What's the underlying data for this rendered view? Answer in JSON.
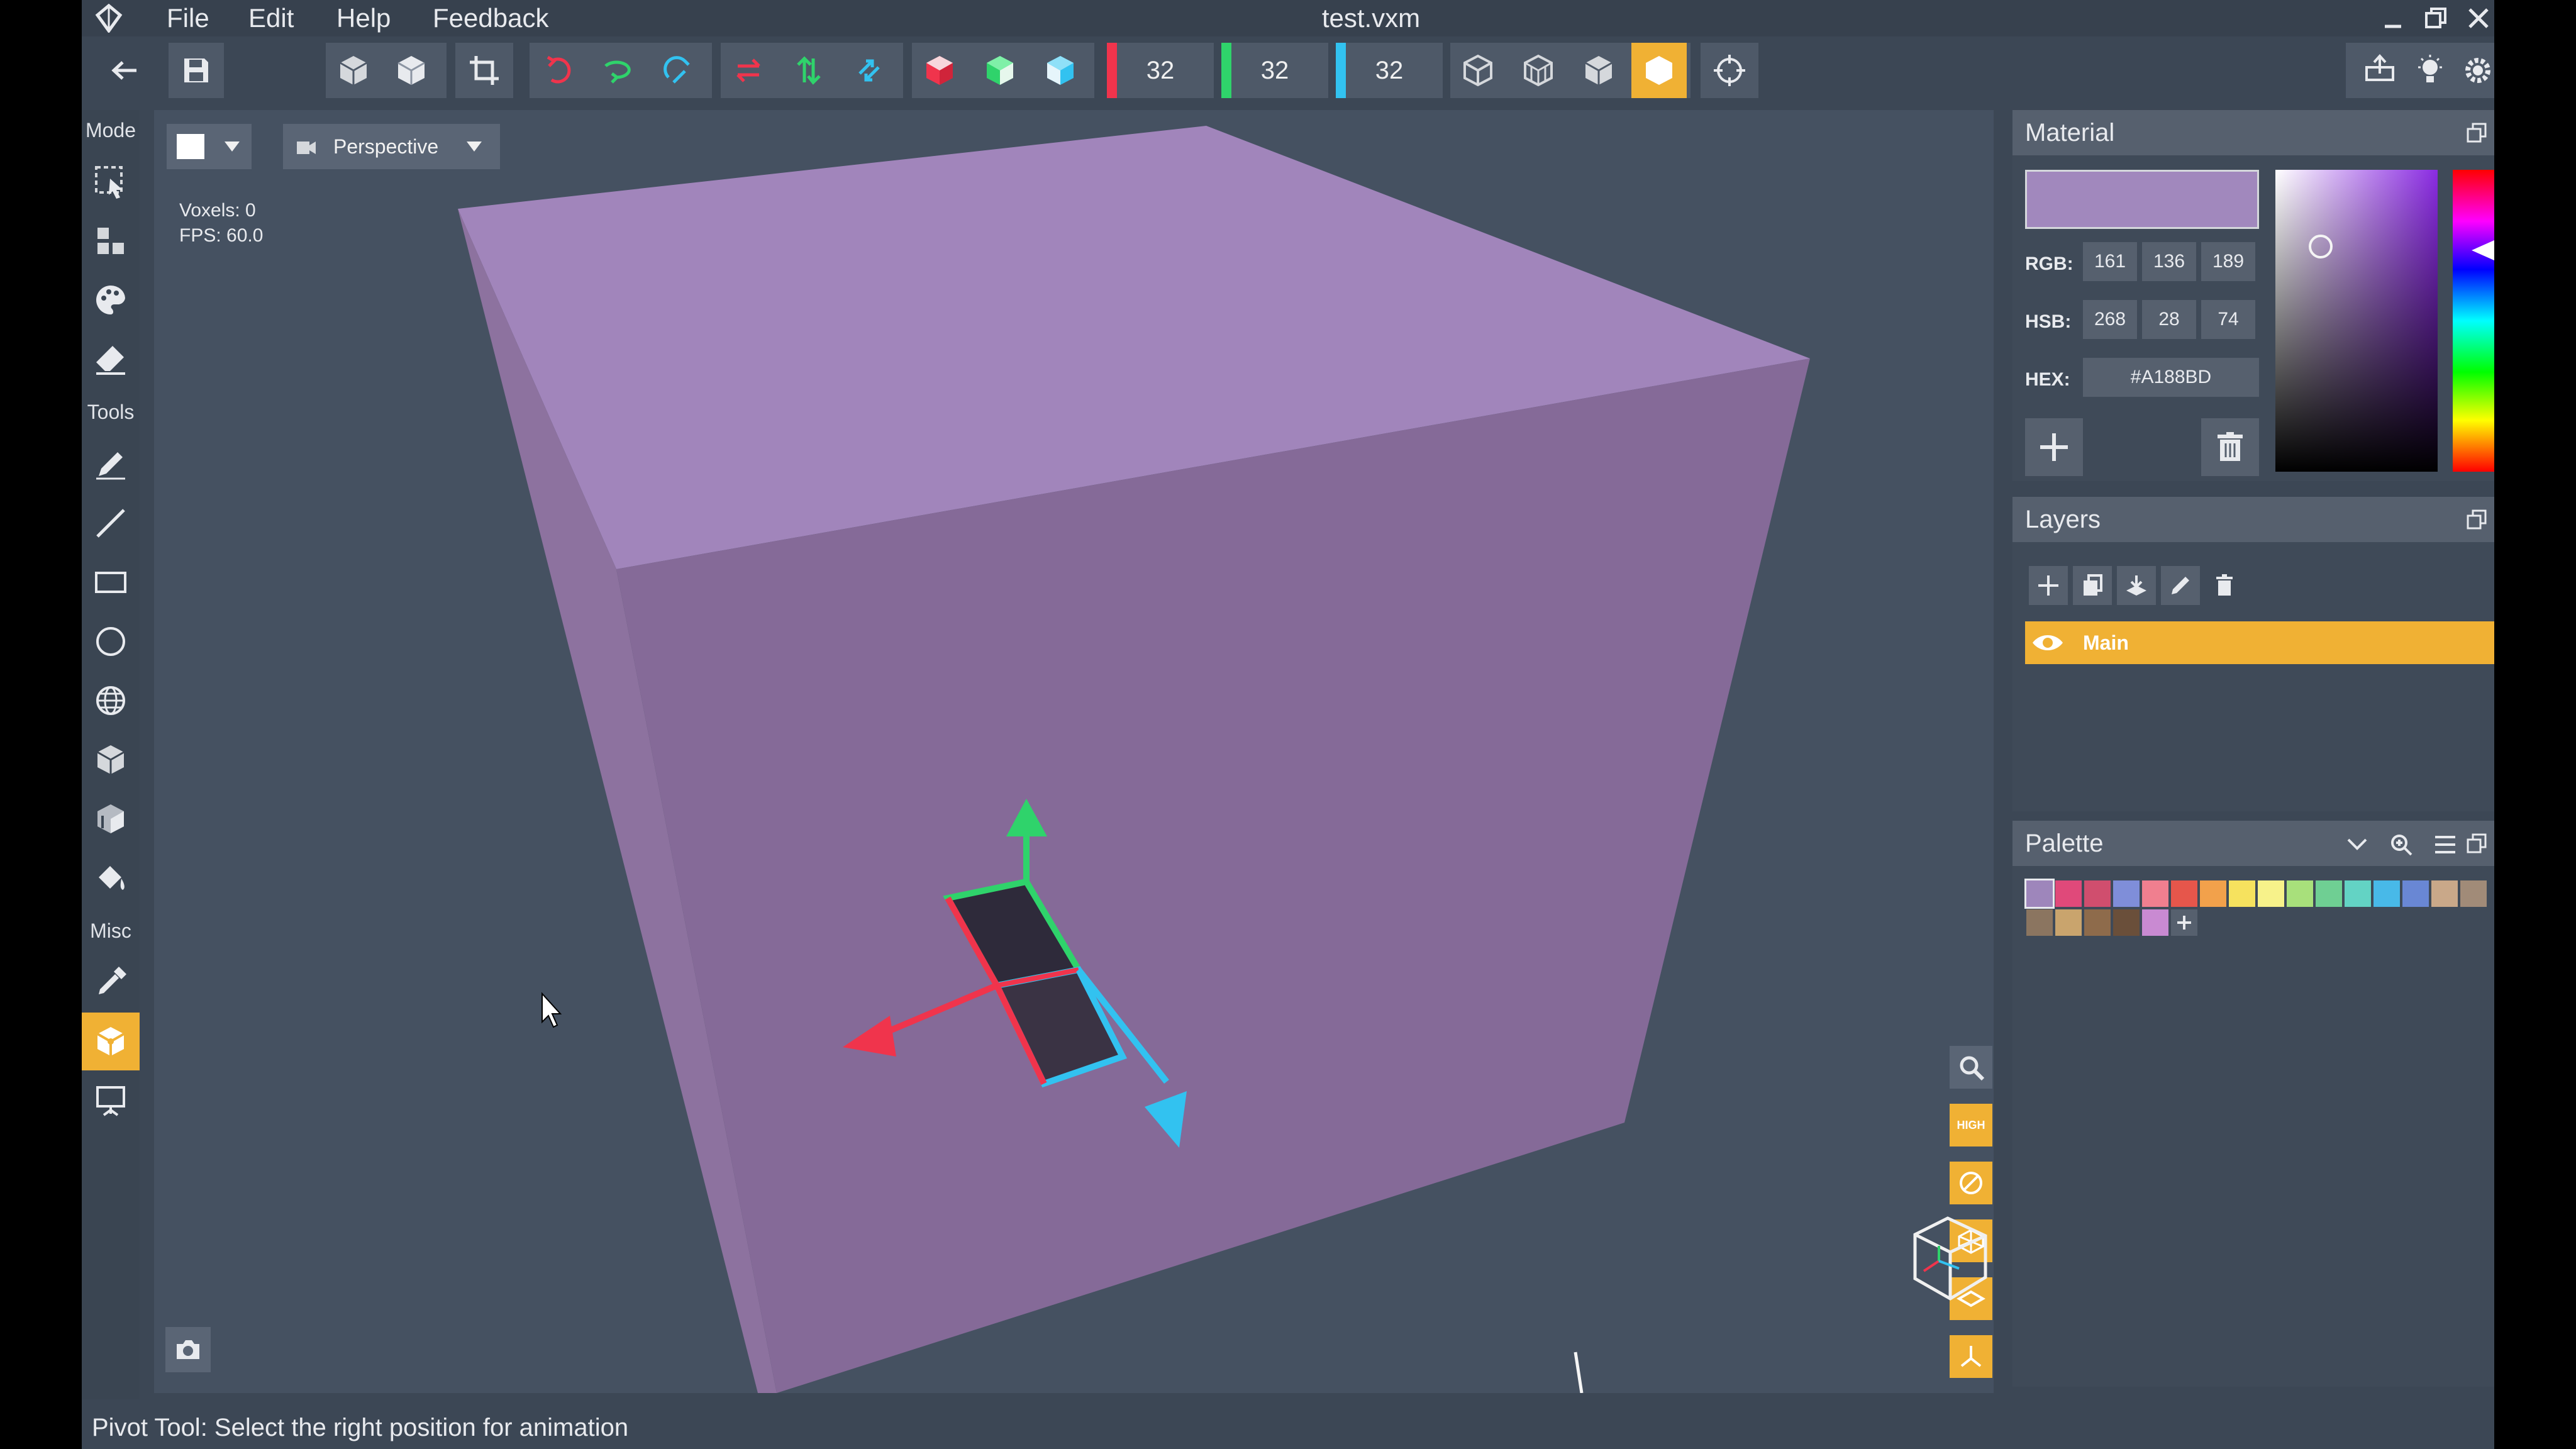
{
  "titlebar": {
    "menu": [
      "File",
      "Edit",
      "Help",
      "Feedback"
    ],
    "title": "test.vxm"
  },
  "toolbar": {
    "size_x": "32",
    "size_y": "32",
    "size_z": "32",
    "colors": {
      "x": "#f0344c",
      "y": "#2fd36b",
      "z": "#32c2f0",
      "accent": "#f0b134"
    }
  },
  "left_rail": {
    "mode_label": "Mode",
    "tools_label": "Tools",
    "misc_label": "Misc"
  },
  "viewport": {
    "color_mode": "",
    "view_mode": "Perspective",
    "voxels": "Voxels: 0",
    "fps": "FPS: 60.0",
    "cube_color": "#A188BD",
    "quality_label": "HIGH"
  },
  "material": {
    "title": "Material",
    "rgb_label": "RGB:",
    "rgb": [
      "161",
      "136",
      "189"
    ],
    "hsb_label": "HSB:",
    "hsb": [
      "268",
      "28",
      "74"
    ],
    "hex_label": "HEX:",
    "hex": "#A188BD"
  },
  "layers": {
    "title": "Layers",
    "items": [
      {
        "name": "Main",
        "visible": true
      }
    ]
  },
  "palette": {
    "title": "Palette",
    "swatches": [
      "#9e86bb",
      "#e0497a",
      "#d04e6e",
      "#7f8ed9",
      "#f07f8f",
      "#e6564b",
      "#f2a14b",
      "#f6e25e",
      "#f7f28a",
      "#a8e07b",
      "#6fcf93",
      "#63d3c4",
      "#48b9e8",
      "#6987d4",
      "#c9a889",
      "#a18b78",
      "#8b7560",
      "#c9a46d",
      "#8e6b4b",
      "#6a4f3a",
      "#c98ad2"
    ]
  },
  "status": {
    "text": "Pivot Tool: Select the right position for animation"
  }
}
